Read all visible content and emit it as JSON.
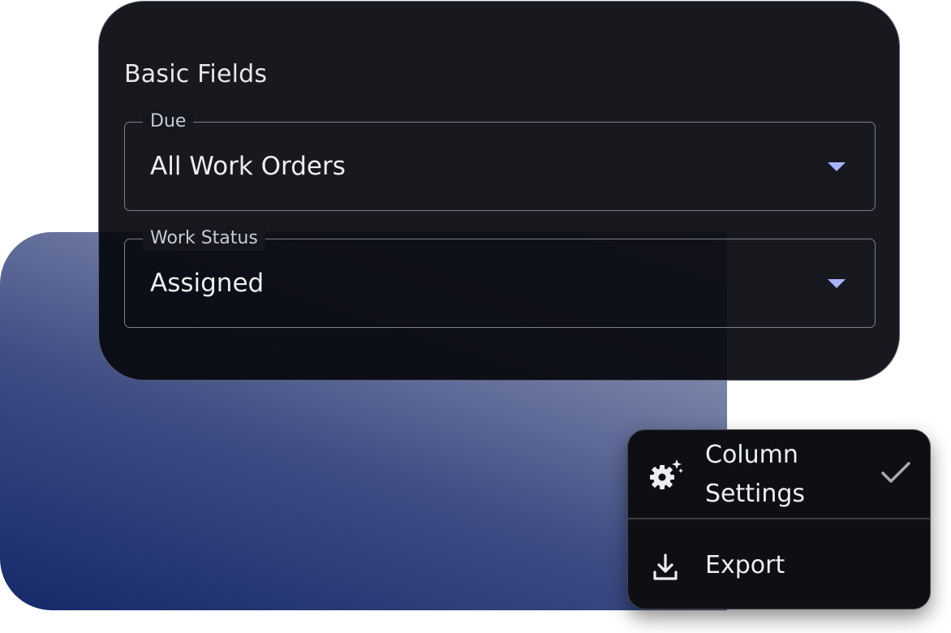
{
  "basic_fields": {
    "title": "Basic Fields",
    "due": {
      "label": "Due",
      "value": "All Work Orders"
    },
    "work_status": {
      "label": "Work Status",
      "value": "Assigned"
    }
  },
  "menu": {
    "column_settings": {
      "label": "Column Settings",
      "checked": true,
      "icon": "gear-sparkle-icon"
    },
    "export": {
      "label": "Export",
      "icon": "download-icon"
    }
  },
  "colors": {
    "accent_caret": "#a9b4ff",
    "panel_bg": "#06080e",
    "gradient_dark": "#15296a",
    "gradient_light": "#8d96b5"
  }
}
